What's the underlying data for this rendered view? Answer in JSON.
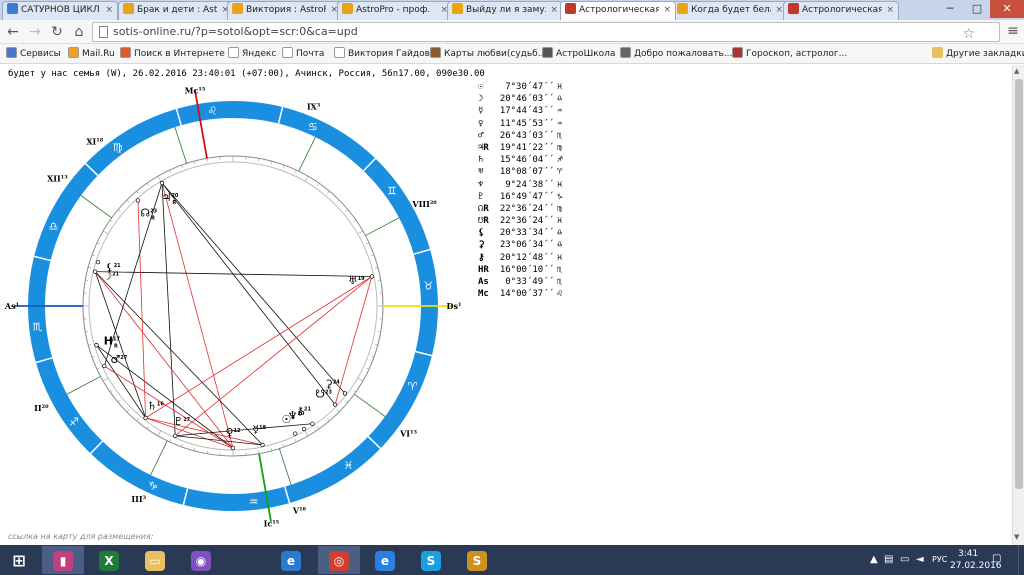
{
  "browser": {
    "tabs": [
      {
        "title": "САТУРНОВ ЦИКЛ",
        "color": "#3d7bd8",
        "active": false
      },
      {
        "title": "Брак и дети : Astro",
        "color": "#e8a317",
        "active": false
      },
      {
        "title": "Виктория : AstroPro",
        "color": "#e8a317",
        "active": false
      },
      {
        "title": "AstroPro - проф.",
        "color": "#e8a317",
        "active": false
      },
      {
        "title": "Выйду ли я замуж",
        "color": "#e8a317",
        "active": false
      },
      {
        "title": "Астрологическая",
        "color": "#c0392b",
        "active": true
      },
      {
        "title": "Когда будет бела",
        "color": "#e8a317",
        "active": false
      },
      {
        "title": "Астрологическая",
        "color": "#c0392b",
        "active": false
      }
    ],
    "url": "sotis-online.ru/?p=sotol&opt=scr:0&ca=upd",
    "bookmarks": [
      {
        "label": "Сервисы",
        "color": "#4a74c9"
      },
      {
        "label": "Mail.Ru",
        "color": "#f0a020"
      },
      {
        "label": "Поиск в Интернете",
        "color": "#e05a2a"
      },
      {
        "label": "Яндекс",
        "color": "#ffffff"
      },
      {
        "label": "Почта",
        "color": "#ffffff"
      },
      {
        "label": "Виктория Гайдова",
        "color": "#ffffff"
      },
      {
        "label": "Карты любви(судьб...",
        "color": "#8b5a2b"
      },
      {
        "label": "АстроШкола",
        "color": "#555555"
      },
      {
        "label": "Добро пожаловать...",
        "color": "#666666"
      },
      {
        "label": "Гороскоп, астролог...",
        "color": "#aa3333"
      }
    ],
    "other_bookmarks": "Другие закладки"
  },
  "page": {
    "header": "будет у нас семья (W), 26.02.2016 23:40:01 (+07:00), Ачинск, Россия, 56n17.00, 090e30.00",
    "link_caption": "ссылка на карту для размещения:"
  },
  "planets": [
    {
      "symbol": "☉",
      "position": "7°30´47´´",
      "sign": "♓"
    },
    {
      "symbol": "☽",
      "position": "20°46´03´´",
      "sign": "♎"
    },
    {
      "symbol": "☿",
      "position": "17°44´43´´",
      "sign": "♒"
    },
    {
      "symbol": "♀",
      "position": "11°45´53´´",
      "sign": "♒"
    },
    {
      "symbol": "♂",
      "position": "26°43´03´´",
      "sign": "♏"
    },
    {
      "symbol": "♃R",
      "position": "19°41´22´´",
      "sign": "♍"
    },
    {
      "symbol": "♄",
      "position": "15°46´04´´",
      "sign": "♐"
    },
    {
      "symbol": "♅",
      "position": "18°08´07´´",
      "sign": "♈"
    },
    {
      "symbol": "♆",
      "position": "9°24´38´´",
      "sign": "♓"
    },
    {
      "symbol": "♇",
      "position": "16°49´47´´",
      "sign": "♑"
    },
    {
      "symbol": "☊R",
      "position": "22°36´24´´",
      "sign": "♍"
    },
    {
      "symbol": "☋R",
      "position": "22°36´24´´",
      "sign": "♓"
    },
    {
      "symbol": "⚸",
      "position": "20°33´34´´",
      "sign": "♎"
    },
    {
      "symbol": "⚳",
      "position": "23°06´34´´",
      "sign": "♎"
    },
    {
      "symbol": "⚷",
      "position": "20°12´48´´",
      "sign": "♓"
    },
    {
      "symbol": "HR",
      "position": "16°00´10´´",
      "sign": "♏"
    },
    {
      "symbol": "As",
      "position": "0°33´49´´",
      "sign": "♏"
    },
    {
      "symbol": "Mc",
      "position": "14°00´37´´",
      "sign": "♌"
    }
  ],
  "wheel": {
    "signs": [
      "♌",
      "♋",
      "♊",
      "♉",
      "♈",
      "♓",
      "♒",
      "♑",
      "♐",
      "♏",
      "♎",
      "♍"
    ],
    "house_labels": [
      {
        "label": "Mc",
        "deg": "15"
      },
      {
        "label": "IX",
        "deg": "3"
      },
      {
        "label": "VIII",
        "deg": "20"
      },
      {
        "label": "Ds",
        "deg": "1"
      },
      {
        "label": "VI",
        "deg": "13"
      },
      {
        "label": "V",
        "deg": "18"
      },
      {
        "label": "Ic",
        "deg": "15"
      },
      {
        "label": "III",
        "deg": "3"
      },
      {
        "label": "II",
        "deg": "20"
      },
      {
        "label": "As",
        "deg": "1"
      },
      {
        "label": "XII",
        "deg": "13"
      },
      {
        "label": "XI",
        "deg": "18"
      }
    ],
    "planet_marks": [
      {
        "glyph": "♃",
        "deg": "20",
        "sub": "R"
      },
      {
        "glyph": "☊",
        "deg": "23",
        "sub": "R"
      },
      {
        "glyph": "☽",
        "deg": "21",
        "sub": ""
      },
      {
        "glyph": "⚸",
        "deg": "21",
        "sub": ""
      },
      {
        "glyph": "♅",
        "deg": "19",
        "sub": ""
      },
      {
        "glyph": "H",
        "deg": "17",
        "sub": "R"
      },
      {
        "glyph": "♂",
        "deg": "27",
        "sub": ""
      },
      {
        "glyph": "♄",
        "deg": "16",
        "sub": ""
      },
      {
        "glyph": "♇",
        "deg": "17",
        "sub": ""
      },
      {
        "glyph": "♀",
        "deg": "12",
        "sub": ""
      },
      {
        "glyph": "☿",
        "deg": "18",
        "sub": ""
      },
      {
        "glyph": "♆",
        "deg": "10",
        "sub": ""
      },
      {
        "glyph": "☉",
        "deg": "8",
        "sub": ""
      },
      {
        "glyph": "⚷",
        "deg": "21",
        "sub": ""
      },
      {
        "glyph": "☋",
        "deg": "23",
        "sub": ""
      },
      {
        "glyph": "⚳",
        "deg": "24",
        "sub": ""
      }
    ],
    "colors": {
      "ring": "#1a8fe0",
      "asc": "#1a5ab0",
      "desc": "#f0e000",
      "mc": "#d01010",
      "ic": "#10a010",
      "red_aspect": "#e03030",
      "black_aspect": "#111111"
    }
  },
  "taskbar": {
    "apps": [
      {
        "name": "chart-app",
        "color": "#c04080",
        "glyph": "▮"
      },
      {
        "name": "excel",
        "color": "#1e7b3a",
        "glyph": "X"
      },
      {
        "name": "explorer",
        "color": "#e8c060",
        "glyph": "▭"
      },
      {
        "name": "picasa",
        "color": "#8050c0",
        "glyph": "◉"
      },
      {
        "name": "ie-edge",
        "color": "#2a7ad0",
        "glyph": "e"
      },
      {
        "name": "chrome",
        "color": "#d04030",
        "glyph": "◎"
      },
      {
        "name": "internet-explorer",
        "color": "#2a80e0",
        "glyph": "e"
      },
      {
        "name": "skype",
        "color": "#1aa0e0",
        "glyph": "S"
      },
      {
        "name": "sotis",
        "color": "#d09020",
        "glyph": "S"
      }
    ],
    "language": "РУС",
    "time": "3:41",
    "date": "27.02.2016"
  }
}
